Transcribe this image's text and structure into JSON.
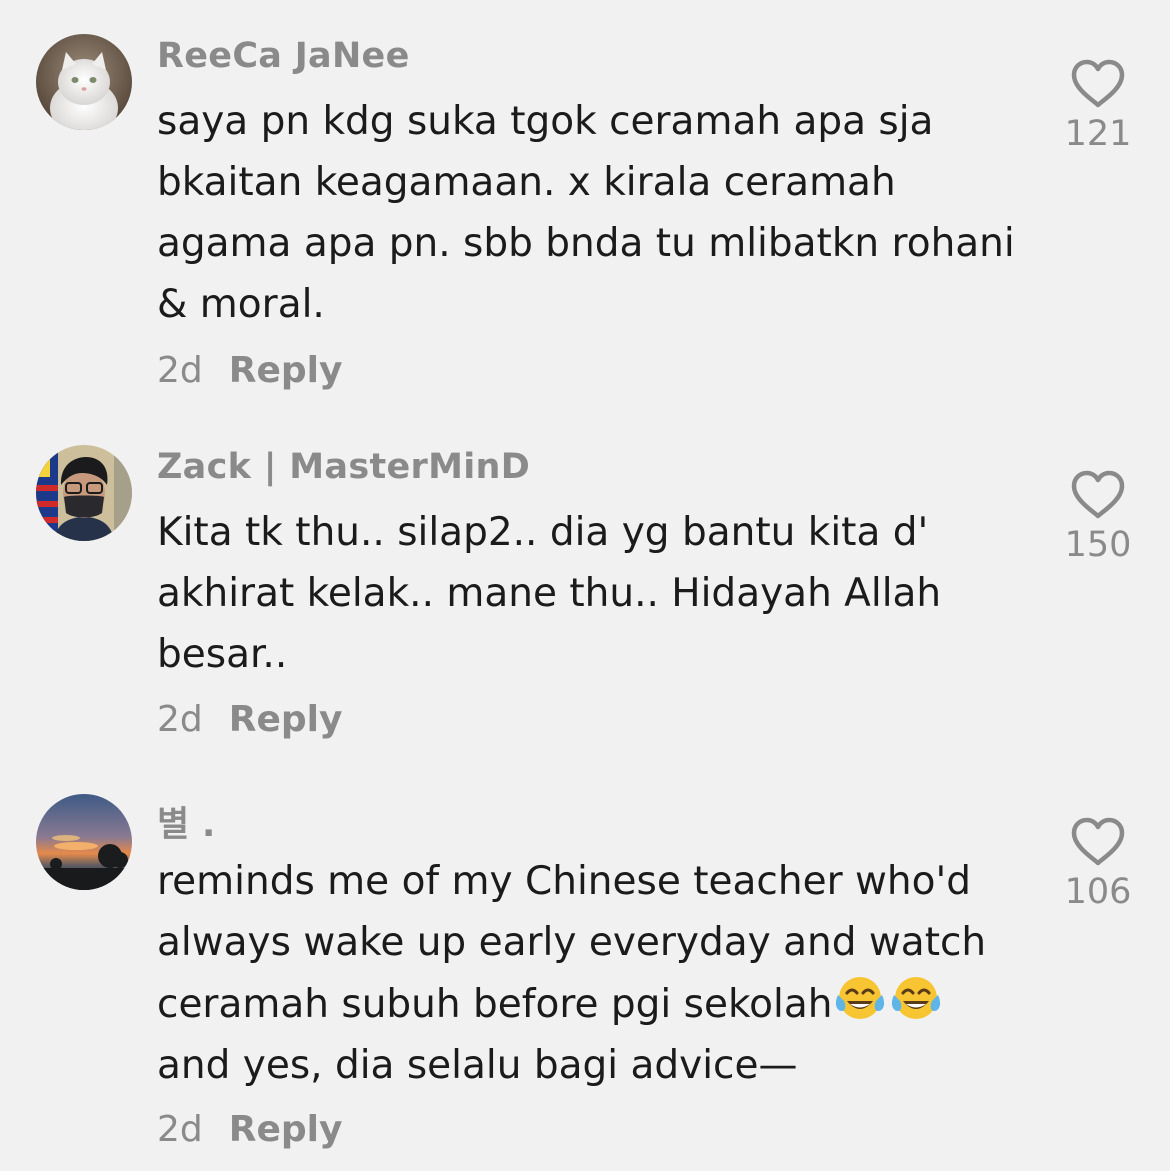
{
  "comments": [
    {
      "username": "ReeCa JaNee",
      "text": "saya pn kdg suka tgok ceramah apa sja\nbkaitan keagamaan. x kirala ceramah\nagama apa pn. sbb bnda tu mlibatkn rohani\n& moral.",
      "time": "2d",
      "reply_label": "Reply",
      "likes": "121",
      "avatar": "white-cat-avatar",
      "like_icon": "heart-outline-icon"
    },
    {
      "username": "Zack | MasterMinD",
      "text": "Kita tk thu.. silap2.. dia yg bantu kita d'\nakhirat kelak.. mane thu.. Hidayah Allah\nbesar..",
      "time": "2d",
      "reply_label": "Reply",
      "likes": "150",
      "avatar": "masked-person-avatar",
      "like_icon": "heart-outline-icon"
    },
    {
      "username": "별 .",
      "text_before_emoji": "reminds me of my Chinese teacher who'd\nalways wake up early everyday and watch\nceramah subuh before pgi sekolah",
      "emoji": [
        "tears-of-joy-emoji",
        "tears-of-joy-emoji"
      ],
      "text_after_emoji": "and yes, dia selalu bagi advice—",
      "time": "2d",
      "reply_label": "Reply",
      "likes": "106",
      "avatar": "sunset-avatar",
      "like_icon": "heart-outline-icon"
    }
  ],
  "colors": {
    "background": "#f1f1f1",
    "text": "#1b1b1b",
    "muted": "#8a8a8a"
  }
}
